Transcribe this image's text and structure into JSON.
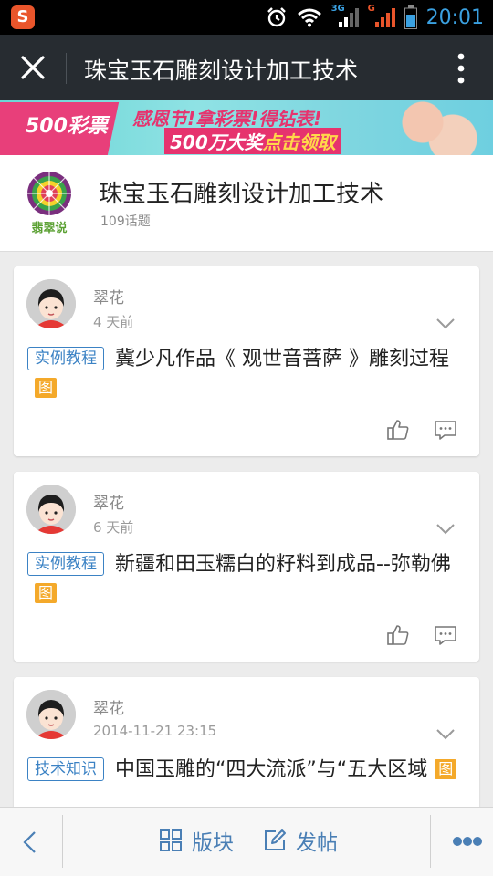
{
  "status_bar": {
    "time": "20:01",
    "network_1": "3G",
    "network_2": "G",
    "icons": [
      "app-s-icon",
      "alarm-icon",
      "wifi-icon",
      "signal-icon",
      "battery-icon"
    ]
  },
  "app_bar": {
    "title": "珠宝玉石雕刻设计加工技术",
    "icons": [
      "close-icon",
      "more-vertical-icon"
    ]
  },
  "banner": {
    "logo_text": "500彩票",
    "line1": "感恩节!拿彩票!得钻表!",
    "line2_prefix": "500万大奖",
    "line2_highlight": "点击领取"
  },
  "forum": {
    "logo_text": "翡翠说",
    "name": "珠宝玉石雕刻设计加工技术",
    "topic_count": "109话题"
  },
  "posts": [
    {
      "author": "翠花",
      "time": "4 天前",
      "tag": "实例教程",
      "title": "冀少凡作品《 观世音菩萨 》雕刻过程",
      "badge": "图"
    },
    {
      "author": "翠花",
      "time": "6 天前",
      "tag": "实例教程",
      "title": "新疆和田玉糯白的籽料到成品--弥勒佛",
      "badge": "图"
    },
    {
      "author": "翠花",
      "time": "2014-11-21 23:15",
      "tag": "技术知识",
      "title": "中国玉雕的“四大流派”与“五大区域",
      "badge": "图"
    }
  ],
  "bottom_bar": {
    "board_label": "版块",
    "post_label": "发帖"
  },
  "colors": {
    "app_bar": "#272c31",
    "accent_blue": "#3b82c4",
    "badge_orange": "#f4a92a",
    "time_blue": "#3aa0e0"
  }
}
